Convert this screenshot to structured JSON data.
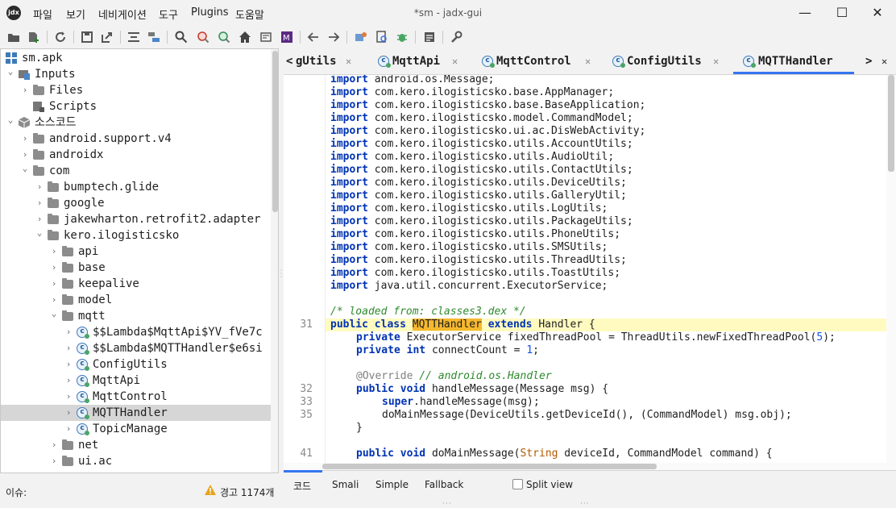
{
  "window": {
    "title": "*sm - jadx-gui",
    "app_icon": "jadx-logo",
    "minimize": "—",
    "maximize": "☐",
    "close": "✕"
  },
  "menu": [
    "파일",
    "보기",
    "네비게이션",
    "도구",
    "Plugins",
    "도움말"
  ],
  "toolbar_icons": [
    "open-folder-icon",
    "add-files-icon",
    "reload-icon",
    "save-icon",
    "export-icon",
    "sync-icon",
    "flatten-icon",
    "search-icon",
    "find-class-icon",
    "find-usage-icon",
    "home-icon",
    "deobf-icon",
    "smali-icon",
    "back-icon",
    "forward-icon",
    "quark-icon",
    "preview-icon",
    "debug-icon",
    "log-icon",
    "settings-icon"
  ],
  "tree": [
    {
      "label": "sm.apk",
      "level": 0,
      "icon": "apk-icon",
      "arrow": ""
    },
    {
      "label": "Inputs",
      "level": 0,
      "icon": "inputs-icon",
      "arrow": "v"
    },
    {
      "label": "Files",
      "level": 1,
      "icon": "folder-icon",
      "arrow": ">"
    },
    {
      "label": "Scripts",
      "level": 1,
      "icon": "scripts-icon",
      "arrow": ""
    },
    {
      "label": "소스코드",
      "level": 0,
      "icon": "source-icon",
      "arrow": "v"
    },
    {
      "label": "android.support.v4",
      "level": 1,
      "icon": "folder-icon",
      "arrow": ">"
    },
    {
      "label": "androidx",
      "level": 1,
      "icon": "folder-icon",
      "arrow": ">"
    },
    {
      "label": "com",
      "level": 1,
      "icon": "folder-icon",
      "arrow": "v"
    },
    {
      "label": "bumptech.glide",
      "level": 2,
      "icon": "folder-icon",
      "arrow": ">"
    },
    {
      "label": "google",
      "level": 2,
      "icon": "folder-icon",
      "arrow": ">"
    },
    {
      "label": "jakewharton.retrofit2.adapter",
      "level": 2,
      "icon": "folder-icon",
      "arrow": ">"
    },
    {
      "label": "kero.ilogisticsko",
      "level": 2,
      "icon": "folder-icon",
      "arrow": "v"
    },
    {
      "label": "api",
      "level": 3,
      "icon": "folder-icon",
      "arrow": ">"
    },
    {
      "label": "base",
      "level": 3,
      "icon": "folder-icon",
      "arrow": ">"
    },
    {
      "label": "keepalive",
      "level": 3,
      "icon": "folder-icon",
      "arrow": ">"
    },
    {
      "label": "model",
      "level": 3,
      "icon": "folder-icon",
      "arrow": ">"
    },
    {
      "label": "mqtt",
      "level": 3,
      "icon": "folder-icon",
      "arrow": "v"
    },
    {
      "label": "$$Lambda$MqttApi$YV_fVe7c",
      "level": 4,
      "icon": "class-icon",
      "arrow": ">"
    },
    {
      "label": "$$Lambda$MQTTHandler$e6si",
      "level": 4,
      "icon": "class-icon",
      "arrow": ">"
    },
    {
      "label": "ConfigUtils",
      "level": 4,
      "icon": "class-icon",
      "arrow": ">"
    },
    {
      "label": "MqttApi",
      "level": 4,
      "icon": "class-icon",
      "arrow": ">"
    },
    {
      "label": "MqttControl",
      "level": 4,
      "icon": "class-icon",
      "arrow": ">"
    },
    {
      "label": "MQTTHandler",
      "level": 4,
      "icon": "class-icon",
      "arrow": ">",
      "selected": true
    },
    {
      "label": "TopicManage",
      "level": 4,
      "icon": "class-icon",
      "arrow": ">"
    },
    {
      "label": "net",
      "level": 3,
      "icon": "folder-icon",
      "arrow": ">"
    },
    {
      "label": "ui.ac",
      "level": 3,
      "icon": "folder-icon",
      "arrow": ">"
    }
  ],
  "tabs": {
    "prev_arrow": "<",
    "next_arrow": ">",
    "close_glyph": "✕",
    "items": [
      {
        "label": "gUtils",
        "icon": false
      },
      {
        "label": "MqttApi",
        "icon": true
      },
      {
        "label": "MqttControl",
        "icon": true
      },
      {
        "label": "ConfigUtils",
        "icon": true
      },
      {
        "label": "MQTTHandler",
        "icon": true,
        "active": true
      }
    ]
  },
  "code": {
    "imports": [
      "android.os.Message;",
      "com.kero.ilogisticsko.base.AppManager;",
      "com.kero.ilogisticsko.base.BaseApplication;",
      "com.kero.ilogisticsko.model.CommandModel;",
      "com.kero.ilogisticsko.ui.ac.DisWebActivity;",
      "com.kero.ilogisticsko.utils.AccountUtils;",
      "com.kero.ilogisticsko.utils.AudioUtil;",
      "com.kero.ilogisticsko.utils.ContactUtils;",
      "com.kero.ilogisticsko.utils.DeviceUtils;",
      "com.kero.ilogisticsko.utils.GalleryUtil;",
      "com.kero.ilogisticsko.utils.LogUtils;",
      "com.kero.ilogisticsko.utils.PackageUtils;",
      "com.kero.ilogisticsko.utils.PhoneUtils;",
      "com.kero.ilogisticsko.utils.SMSUtils;",
      "com.kero.ilogisticsko.utils.ThreadUtils;",
      "com.kero.ilogisticsko.utils.ToastUtils;",
      "java.util.concurrent.ExecutorService;"
    ],
    "import_kw": "import",
    "loaded_from_comment": "/* loaded from: classes3.dex */",
    "class_line_no": "31",
    "kw_public": "public",
    "kw_class": "class",
    "class_name": "MQTTHandler",
    "kw_extends": "extends",
    "super_class": "Handler {",
    "kw_private": "private",
    "field1_rest": "ExecutorService fixedThreadPool = ThreadUtils.newFixedThreadPool(",
    "field1_num": "5",
    "field1_end": ");",
    "kw_int": "int",
    "field2_rest": "connectCount = ",
    "field2_num": "1",
    "field2_end": ";",
    "override_ann": "@Override",
    "override_cmt": "// android.os.Handler",
    "ln_32": "32",
    "kw_void": "void",
    "m1_sig": "handleMessage(Message msg) {",
    "ln_33": "33",
    "kw_super": "super",
    "m1_l1": ".handleMessage(msg);",
    "ln_35": "35",
    "m1_l2": "doMainMessage(DeviceUtils.getDeviceId(), (CommandModel) msg.obj);",
    "close_brace": "}",
    "ln_41": "41",
    "m2_sig_a": "doMainMessage(",
    "m2_type": "String",
    "m2_sig_b": " deviceId, CommandModel command) {"
  },
  "bottom_tabs": [
    "코드",
    "Smali",
    "Simple",
    "Fallback"
  ],
  "split_view": {
    "label": "Split view",
    "checked": false
  },
  "status": {
    "issues": "이슈:",
    "warnings": "경고 1174개"
  },
  "colors": {
    "accent": "#3574f0",
    "selection": "#d6d6d6",
    "highlight_line": "#fffbc0",
    "highlight_word": "#f5b82e",
    "keyword": "#0033b3",
    "comment": "#2f8a2f"
  }
}
